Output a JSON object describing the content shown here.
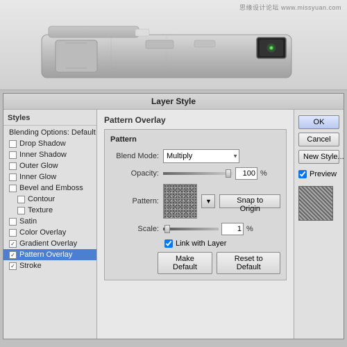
{
  "watermark": "思缘设计论坛  www.missyuan.com",
  "dialog": {
    "title": "Layer Style"
  },
  "styles_panel": {
    "title": "Styles",
    "items": [
      {
        "label": "Blending Options: Default",
        "checked": false,
        "selected": false,
        "indent": false,
        "id": "blending-options"
      },
      {
        "label": "Drop Shadow",
        "checked": false,
        "selected": false,
        "indent": false,
        "id": "drop-shadow"
      },
      {
        "label": "Inner Shadow",
        "checked": false,
        "selected": false,
        "indent": false,
        "id": "inner-shadow"
      },
      {
        "label": "Outer Glow",
        "checked": false,
        "selected": false,
        "indent": false,
        "id": "outer-glow"
      },
      {
        "label": "Inner Glow",
        "checked": false,
        "selected": false,
        "indent": false,
        "id": "inner-glow"
      },
      {
        "label": "Bevel and Emboss",
        "checked": false,
        "selected": false,
        "indent": false,
        "id": "bevel-emboss"
      },
      {
        "label": "Contour",
        "checked": false,
        "selected": false,
        "indent": true,
        "id": "contour"
      },
      {
        "label": "Texture",
        "checked": false,
        "selected": false,
        "indent": true,
        "id": "texture"
      },
      {
        "label": "Satin",
        "checked": false,
        "selected": false,
        "indent": false,
        "id": "satin"
      },
      {
        "label": "Color Overlay",
        "checked": false,
        "selected": false,
        "indent": false,
        "id": "color-overlay"
      },
      {
        "label": "Gradient Overlay",
        "checked": true,
        "selected": false,
        "indent": false,
        "id": "gradient-overlay"
      },
      {
        "label": "Pattern Overlay",
        "checked": true,
        "selected": true,
        "indent": false,
        "id": "pattern-overlay"
      },
      {
        "label": "Stroke",
        "checked": true,
        "selected": false,
        "indent": false,
        "id": "stroke"
      }
    ]
  },
  "main_panel": {
    "section_title": "Pattern Overlay",
    "subsection_title": "Pattern",
    "blend_mode": {
      "label": "Blend Mode:",
      "value": "Multiply"
    },
    "opacity": {
      "label": "Opacity:",
      "value": "100",
      "unit": "%"
    },
    "pattern_label": "Pattern:",
    "snap_button": "Snap to Origin",
    "scale": {
      "label": "Scale:",
      "value": "1",
      "unit": "%"
    },
    "link_layer": {
      "label": "Link with Layer",
      "checked": true
    },
    "make_default_btn": "Make Default",
    "reset_default_btn": "Reset to Default"
  },
  "right_panel": {
    "ok_btn": "OK",
    "cancel_btn": "Cancel",
    "new_style_btn": "New Style...",
    "preview_label": "Preview",
    "preview_checked": true
  }
}
